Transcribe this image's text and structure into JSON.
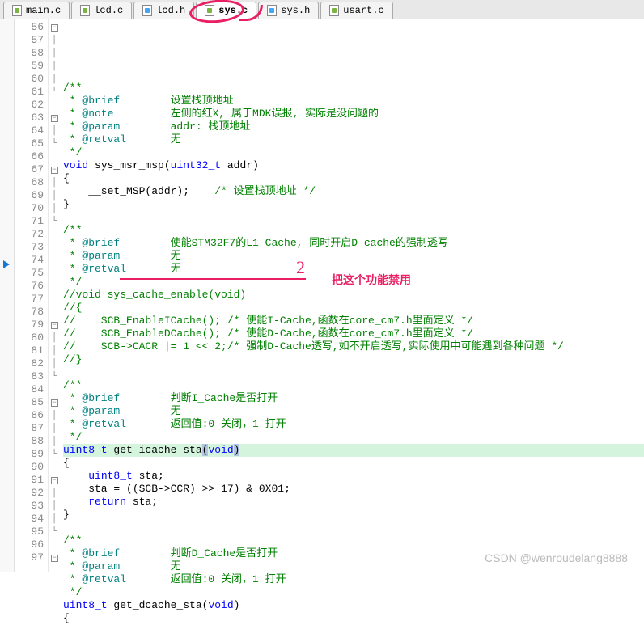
{
  "tabs": [
    {
      "name": "main.c",
      "type": "c"
    },
    {
      "name": "lcd.c",
      "type": "c"
    },
    {
      "name": "lcd.h",
      "type": "h"
    },
    {
      "name": "sys.c",
      "type": "c",
      "active": true
    },
    {
      "name": "sys.h",
      "type": "h"
    },
    {
      "name": "usart.c",
      "type": "c"
    }
  ],
  "annot": {
    "num": "2",
    "text": "把这个功能禁用"
  },
  "watermark": "CSDN @wenroudelang8888",
  "lines": [
    {
      "n": 56,
      "f": "-",
      "tokens": [
        [
          "cm",
          "/**"
        ]
      ]
    },
    {
      "n": 57,
      "f": "|",
      "tokens": [
        [
          "cm",
          " * "
        ],
        [
          "cmd",
          "@brief"
        ],
        [
          "cm",
          "        设置栈顶地址"
        ]
      ]
    },
    {
      "n": 58,
      "f": "|",
      "tokens": [
        [
          "cm",
          " * "
        ],
        [
          "cmd",
          "@note"
        ],
        [
          "cm",
          "         左侧的红X, 属于MDK误报, 实际是没问题的"
        ]
      ]
    },
    {
      "n": 59,
      "f": "|",
      "tokens": [
        [
          "cm",
          " * "
        ],
        [
          "cmd",
          "@param"
        ],
        [
          "cm",
          "        addr: 栈顶地址"
        ]
      ]
    },
    {
      "n": 60,
      "f": "|",
      "tokens": [
        [
          "cm",
          " * "
        ],
        [
          "cmd",
          "@retval"
        ],
        [
          "cm",
          "       无"
        ]
      ]
    },
    {
      "n": 61,
      "f": "e",
      "tokens": [
        [
          "cm",
          " */"
        ]
      ]
    },
    {
      "n": 62,
      "f": "",
      "tokens": [
        [
          "kw",
          "void"
        ],
        [
          "",
          " sys_msr_msp("
        ],
        [
          "ty",
          "uint32_t"
        ],
        [
          "",
          " addr)"
        ]
      ]
    },
    {
      "n": 63,
      "f": "-",
      "tokens": [
        [
          "",
          "{"
        ]
      ]
    },
    {
      "n": 64,
      "f": "|",
      "tokens": [
        [
          "",
          "    __set_MSP(addr);    "
        ],
        [
          "cm",
          "/* 设置栈顶地址 */"
        ]
      ]
    },
    {
      "n": 65,
      "f": "e",
      "tokens": [
        [
          "",
          "}"
        ]
      ]
    },
    {
      "n": 66,
      "f": "",
      "tokens": [
        [
          "",
          ""
        ]
      ]
    },
    {
      "n": 67,
      "f": "-",
      "tokens": [
        [
          "cm",
          "/**"
        ]
      ]
    },
    {
      "n": 68,
      "f": "|",
      "tokens": [
        [
          "cm",
          " * "
        ],
        [
          "cmd",
          "@brief"
        ],
        [
          "cm",
          "        使能STM32F7的L1-Cache, 同时开启D cache的强制透写"
        ]
      ]
    },
    {
      "n": 69,
      "f": "|",
      "tokens": [
        [
          "cm",
          " * "
        ],
        [
          "cmd",
          "@param"
        ],
        [
          "cm",
          "        无"
        ]
      ]
    },
    {
      "n": 70,
      "f": "|",
      "tokens": [
        [
          "cm",
          " * "
        ],
        [
          "cmd",
          "@retval"
        ],
        [
          "cm",
          "       无"
        ]
      ]
    },
    {
      "n": 71,
      "f": "e",
      "tokens": [
        [
          "cm",
          " */"
        ]
      ]
    },
    {
      "n": 72,
      "f": "",
      "tokens": [
        [
          "cm",
          "//void sys_cache_enable(void)"
        ]
      ]
    },
    {
      "n": 73,
      "f": "",
      "tokens": [
        [
          "cm",
          "//{"
        ]
      ]
    },
    {
      "n": 74,
      "f": "",
      "tokens": [
        [
          "cm",
          "//    SCB_EnableICache(); /* 使能I-Cache,函数在core_cm7.h里面定义 */"
        ]
      ]
    },
    {
      "n": 75,
      "f": "",
      "tokens": [
        [
          "cm",
          "//    SCB_EnableDCache(); /* 使能D-Cache,函数在core_cm7.h里面定义 */"
        ]
      ]
    },
    {
      "n": 76,
      "f": "",
      "tokens": [
        [
          "cm",
          "//    SCB->CACR |= 1 << 2;/* 强制D-Cache透写,如不开启透写,实际使用中可能遇到各种问题 */"
        ]
      ]
    },
    {
      "n": 77,
      "f": "",
      "tokens": [
        [
          "cm",
          "//}"
        ]
      ]
    },
    {
      "n": 78,
      "f": "",
      "tokens": [
        [
          "",
          ""
        ]
      ]
    },
    {
      "n": 79,
      "f": "-",
      "tokens": [
        [
          "cm",
          "/**"
        ]
      ]
    },
    {
      "n": 80,
      "f": "|",
      "tokens": [
        [
          "cm",
          " * "
        ],
        [
          "cmd",
          "@brief"
        ],
        [
          "cm",
          "        判断I_Cache是否打开"
        ]
      ]
    },
    {
      "n": 81,
      "f": "|",
      "tokens": [
        [
          "cm",
          " * "
        ],
        [
          "cmd",
          "@param"
        ],
        [
          "cm",
          "        无"
        ]
      ]
    },
    {
      "n": 82,
      "f": "|",
      "tokens": [
        [
          "cm",
          " * "
        ],
        [
          "cmd",
          "@retval"
        ],
        [
          "cm",
          "       返回值:0 关闭，1 打开"
        ]
      ]
    },
    {
      "n": 83,
      "f": "e",
      "tokens": [
        [
          "cm",
          " */"
        ]
      ]
    },
    {
      "n": 84,
      "f": "",
      "hl": true,
      "tokens": [
        [
          "ty",
          "uint8_t"
        ],
        [
          "",
          " get_icache_sta"
        ],
        [
          "paren",
          "("
        ],
        [
          "kw",
          "void"
        ],
        [
          "paren",
          ")"
        ]
      ]
    },
    {
      "n": 85,
      "f": "-",
      "tokens": [
        [
          "",
          "{"
        ]
      ]
    },
    {
      "n": 86,
      "f": "|",
      "tokens": [
        [
          "",
          "    "
        ],
        [
          "ty",
          "uint8_t"
        ],
        [
          "",
          " sta;"
        ]
      ]
    },
    {
      "n": 87,
      "f": "|",
      "tokens": [
        [
          "",
          "    sta = ((SCB->CCR) >> "
        ],
        [
          "num",
          "17"
        ],
        [
          "",
          ") & "
        ],
        [
          "num",
          "0X01"
        ],
        [
          "",
          ";"
        ]
      ]
    },
    {
      "n": 88,
      "f": "|",
      "tokens": [
        [
          "",
          "    "
        ],
        [
          "kw",
          "return"
        ],
        [
          "",
          " sta;"
        ]
      ]
    },
    {
      "n": 89,
      "f": "e",
      "tokens": [
        [
          "",
          "}"
        ]
      ]
    },
    {
      "n": 90,
      "f": "",
      "tokens": [
        [
          "",
          ""
        ]
      ]
    },
    {
      "n": 91,
      "f": "-",
      "tokens": [
        [
          "cm",
          "/**"
        ]
      ]
    },
    {
      "n": 92,
      "f": "|",
      "tokens": [
        [
          "cm",
          " * "
        ],
        [
          "cmd",
          "@brief"
        ],
        [
          "cm",
          "        判断D_Cache是否打开"
        ]
      ]
    },
    {
      "n": 93,
      "f": "|",
      "tokens": [
        [
          "cm",
          " * "
        ],
        [
          "cmd",
          "@param"
        ],
        [
          "cm",
          "        无"
        ]
      ]
    },
    {
      "n": 94,
      "f": "|",
      "tokens": [
        [
          "cm",
          " * "
        ],
        [
          "cmd",
          "@retval"
        ],
        [
          "cm",
          "       返回值:0 关闭，1 打开"
        ]
      ]
    },
    {
      "n": 95,
      "f": "e",
      "tokens": [
        [
          "cm",
          " */"
        ]
      ]
    },
    {
      "n": 96,
      "f": "",
      "tokens": [
        [
          "ty",
          "uint8_t"
        ],
        [
          "",
          " get_dcache_sta("
        ],
        [
          "kw",
          "void"
        ],
        [
          "",
          ")"
        ]
      ]
    },
    {
      "n": 97,
      "f": "-",
      "tokens": [
        [
          "",
          "{"
        ]
      ]
    }
  ]
}
